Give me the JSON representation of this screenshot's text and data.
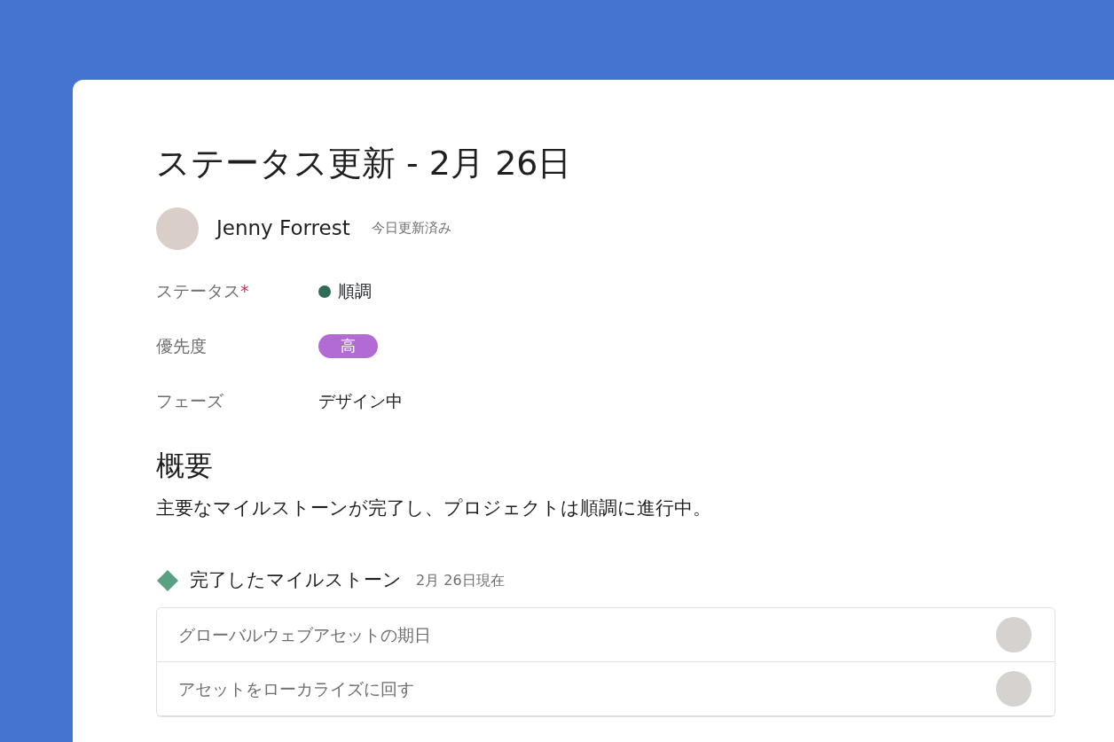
{
  "title": "ステータス更新 - 2月 26日",
  "author": {
    "name": "Jenny Forrest",
    "updated": "今日更新済み"
  },
  "fields": [
    {
      "label": "ステータス",
      "mark": "*",
      "kind": "status",
      "value": "順調",
      "color": "#2f6b56"
    },
    {
      "label": "優先度",
      "kind": "badge",
      "value": "高",
      "color": "#b36bd4"
    },
    {
      "label": "フェーズ",
      "kind": "text",
      "value": "デザイン中"
    }
  ],
  "summary": {
    "heading": "概要",
    "text": "主要なマイルストーンが完了し、プロジェクトは順調に進行中。"
  },
  "milestones": {
    "heading": "完了したマイルストーン",
    "date": "2月 26日現在",
    "items": [
      {
        "name": "グローバルウェブアセットの期日"
      },
      {
        "name": "アセットをローカライズに回す"
      }
    ]
  }
}
